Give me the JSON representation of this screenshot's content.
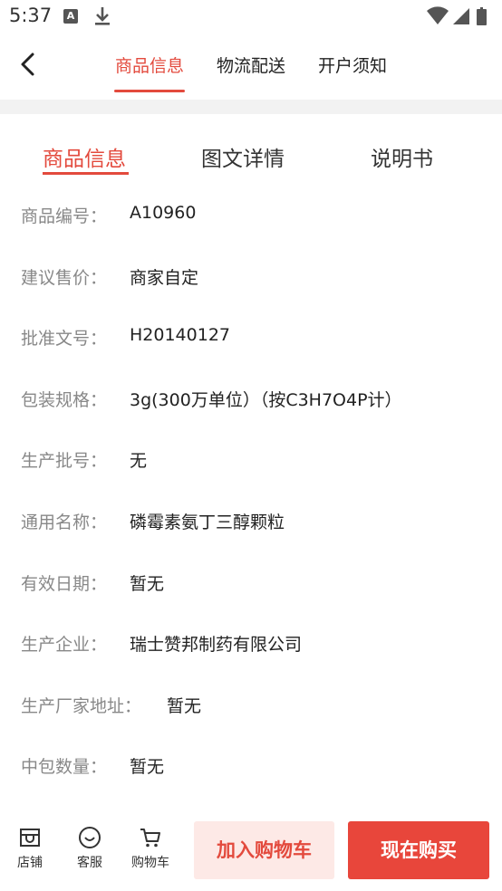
{
  "status_bar": {
    "time": "5:37",
    "icons": [
      "a-notification-icon",
      "download-icon",
      "wifi-icon",
      "cellular-signal-icon",
      "battery-icon"
    ]
  },
  "top_nav": {
    "back_icon": "chevron-left-icon",
    "tabs": [
      {
        "label": "商品信息",
        "active": true
      },
      {
        "label": "物流配送",
        "active": false
      },
      {
        "label": "开户须知",
        "active": false
      }
    ]
  },
  "sub_tabs": [
    {
      "label": "商品信息",
      "active": true
    },
    {
      "label": "图文详情",
      "active": false
    },
    {
      "label": "说明书",
      "active": false
    }
  ],
  "product_info": [
    {
      "label": "商品编号：",
      "value": "A10960"
    },
    {
      "label": "建议售价：",
      "value": "商家自定"
    },
    {
      "label": "批准文号：",
      "value": "H20140127"
    },
    {
      "label": "包装规格：",
      "value": "3g(300万单位）（按C3H7O4P计）"
    },
    {
      "label": "生产批号：",
      "value": "无"
    },
    {
      "label": "通用名称：",
      "value": "磷霉素氨丁三醇颗粒"
    },
    {
      "label": "有效日期：",
      "value": "暂无"
    },
    {
      "label": "生产企业：",
      "value": "瑞士赞邦制药有限公司"
    },
    {
      "label": "生产厂家地址：",
      "value": "暂无"
    },
    {
      "label": "中包数量：",
      "value": "暂无"
    }
  ],
  "bottom_bar": {
    "store": {
      "label": "店铺",
      "icon": "store-icon"
    },
    "service": {
      "label": "客服",
      "icon": "customer-service-icon"
    },
    "cart": {
      "label": "购物车",
      "icon": "cart-icon"
    },
    "add_to_cart": "加入购物车",
    "buy_now": "现在购买"
  },
  "colors": {
    "accent": "#e34a3d",
    "buy_button": "#e8463b",
    "cart_button_bg": "#fde9e6",
    "label_gray": "#888888"
  }
}
